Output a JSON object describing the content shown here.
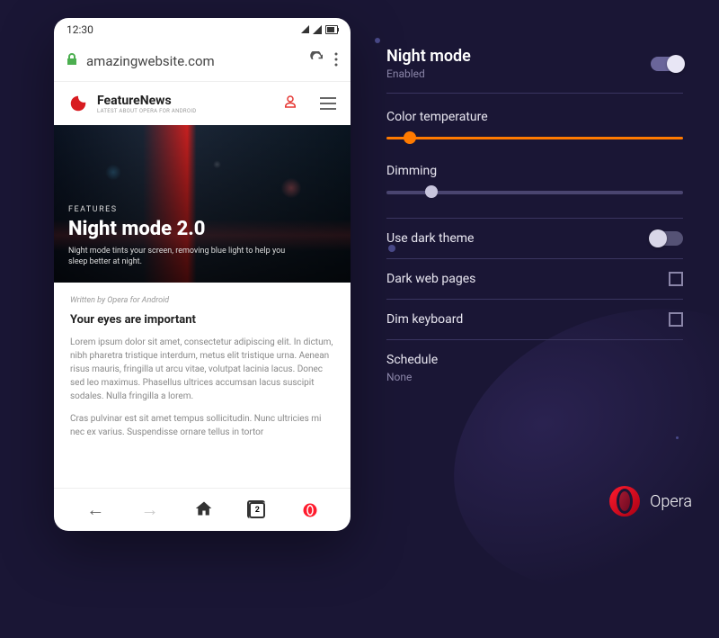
{
  "phone": {
    "status": {
      "time": "12:30"
    },
    "url": {
      "text": "amazingwebsite.com"
    },
    "site": {
      "brand_name": "FeatureNews",
      "brand_sub": "LATEST ABOUT OPERA FOR ANDROID"
    },
    "hero": {
      "tag": "FEATURES",
      "title": "Night mode 2.0",
      "desc": "Night mode tints your screen, removing blue light to help you sleep better at night."
    },
    "article": {
      "by": "Written by Opera for Android",
      "title": "Your eyes are important",
      "p1": "Lorem ipsum dolor sit amet, consectetur adipiscing elit. In dictum, nibh pharetra tristique interdum, metus elit tristique urna. Aenean risus mauris, fringilla ut arcu vitae, volutpat lacinia lacus. Donec sed leo maximus. Phasellus ultrices accumsan lacus suscipit sodales. Nulla fringilla a lorem.",
      "p2": "Cras pulvinar est sit amet tempus sollicitudin. Nunc ultricies mi nec ex varius. Suspendisse ornare tellus in tortor"
    },
    "nav": {
      "tab_count": "2"
    }
  },
  "settings": {
    "night_mode": {
      "title": "Night mode",
      "status": "Enabled"
    },
    "color_temp": {
      "label": "Color temperature",
      "value": 8
    },
    "dimming": {
      "label": "Dimming",
      "value": 15
    },
    "dark_theme": "Use dark theme",
    "dark_pages": "Dark web pages",
    "dim_keyboard": "Dim keyboard",
    "schedule": {
      "label": "Schedule",
      "value": "None"
    }
  },
  "brand": {
    "name": "Opera"
  }
}
